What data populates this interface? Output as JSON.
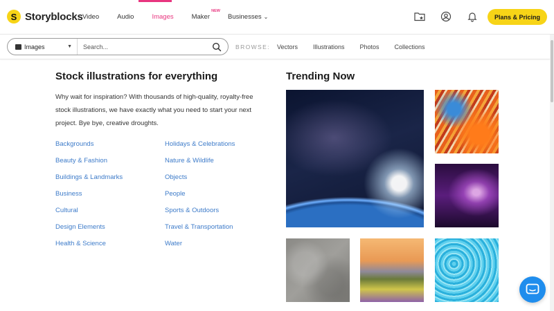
{
  "brand": {
    "logo_mark": "S",
    "name": "Storyblocks"
  },
  "nav": {
    "items": [
      {
        "label": "Video"
      },
      {
        "label": "Audio"
      },
      {
        "label": "Images"
      },
      {
        "label": "Maker",
        "badge": "NEW"
      },
      {
        "label": "Businesses"
      }
    ],
    "active": "Images"
  },
  "header": {
    "cta_label": "Plans & Pricing"
  },
  "search": {
    "category": "Images",
    "placeholder": "Search..."
  },
  "browse": {
    "label": "BROWSE:",
    "links": [
      "Vectors",
      "Illustrations",
      "Photos",
      "Collections"
    ]
  },
  "main": {
    "title": "Stock illustrations for everything",
    "intro": "Why wait for inspiration? With thousands of high-quality, royalty-free stock illustrations, we have exactly what you need to start your next project. Bye bye, creative droughts.",
    "categories_left": [
      "Backgrounds",
      "Beauty & Fashion",
      "Buildings & Landmarks",
      "Business",
      "Cultural",
      "Design Elements",
      "Health & Science"
    ],
    "categories_right": [
      "Holidays & Celebrations",
      "Nature & Wildlife",
      "Objects",
      "People",
      "Sports & Outdoors",
      "Travel & Transportation",
      "Water"
    ]
  },
  "trending": {
    "title": "Trending Now"
  },
  "colors": {
    "accent_pink": "#e8357f",
    "cta_yellow": "#f7d417",
    "link_blue": "#3d7bc9",
    "chat_blue": "#1f8ded"
  }
}
